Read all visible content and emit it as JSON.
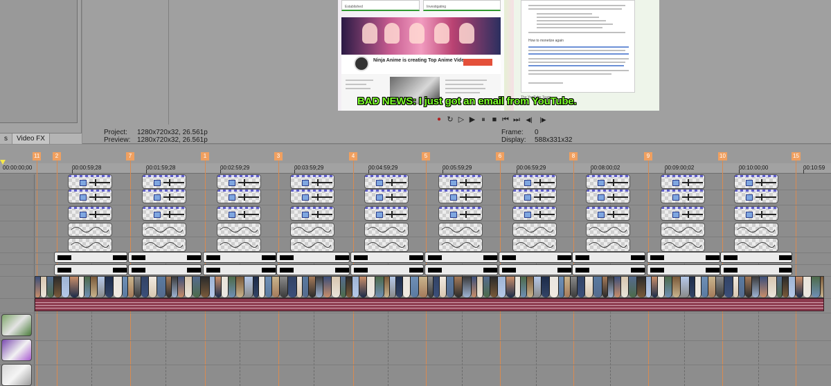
{
  "panel": {
    "tabs": [
      {
        "label": "s"
      },
      {
        "label": "Video FX"
      }
    ]
  },
  "preview": {
    "subtitle": "BAD NEWS: I just got an email from YouTube.",
    "left_card": {
      "box1": "Established",
      "box2": "Investigating",
      "channel_title": "Ninja Anime is creating Top Anime Video"
    },
    "right_card": {
      "heading": "How to monetize again",
      "footer": "The YouTube Team"
    },
    "colors": {
      "subtitle_fill": "#7cff2a",
      "subtitle_outline": "#000000",
      "subscribe_button": "#e4503a"
    }
  },
  "transport": {
    "buttons": [
      {
        "name": "record-icon",
        "glyph": "●"
      },
      {
        "name": "loop-icon",
        "glyph": "↻"
      },
      {
        "name": "play-from-start-icon",
        "glyph": "▷"
      },
      {
        "name": "play-icon",
        "glyph": "▶"
      },
      {
        "name": "pause-icon",
        "glyph": "⏸"
      },
      {
        "name": "stop-icon",
        "glyph": "■"
      },
      {
        "name": "go-to-start-icon",
        "glyph": "⏮"
      },
      {
        "name": "go-to-end-icon",
        "glyph": "⏭"
      },
      {
        "name": "previous-frame-icon",
        "glyph": "◀|"
      },
      {
        "name": "next-frame-icon",
        "glyph": "|▶"
      }
    ]
  },
  "project_info": {
    "project_label": "Project:",
    "project_value": "1280x720x32, 26.561p",
    "preview_label": "Preview:",
    "preview_value": "1280x720x32, 26.561p",
    "frame_label": "Frame:",
    "frame_value": "0",
    "display_label": "Display:",
    "display_value": "588x331x32"
  },
  "timeline": {
    "cursor_time": "00:00:00;00",
    "markers": [
      "11",
      "2",
      "7",
      "1",
      "3",
      "4",
      "5",
      "6",
      "8",
      "9",
      "10",
      "15"
    ],
    "time_labels": [
      "00:00:59;28",
      "00:01:59;28",
      "00:02:59;29",
      "00:03:59;29",
      "00:04:59;29",
      "00:05:59;29",
      "00:06:59;29",
      "00:08:00;02",
      "00:09:00;02",
      "00:10:00;00",
      "00:10:59"
    ]
  }
}
